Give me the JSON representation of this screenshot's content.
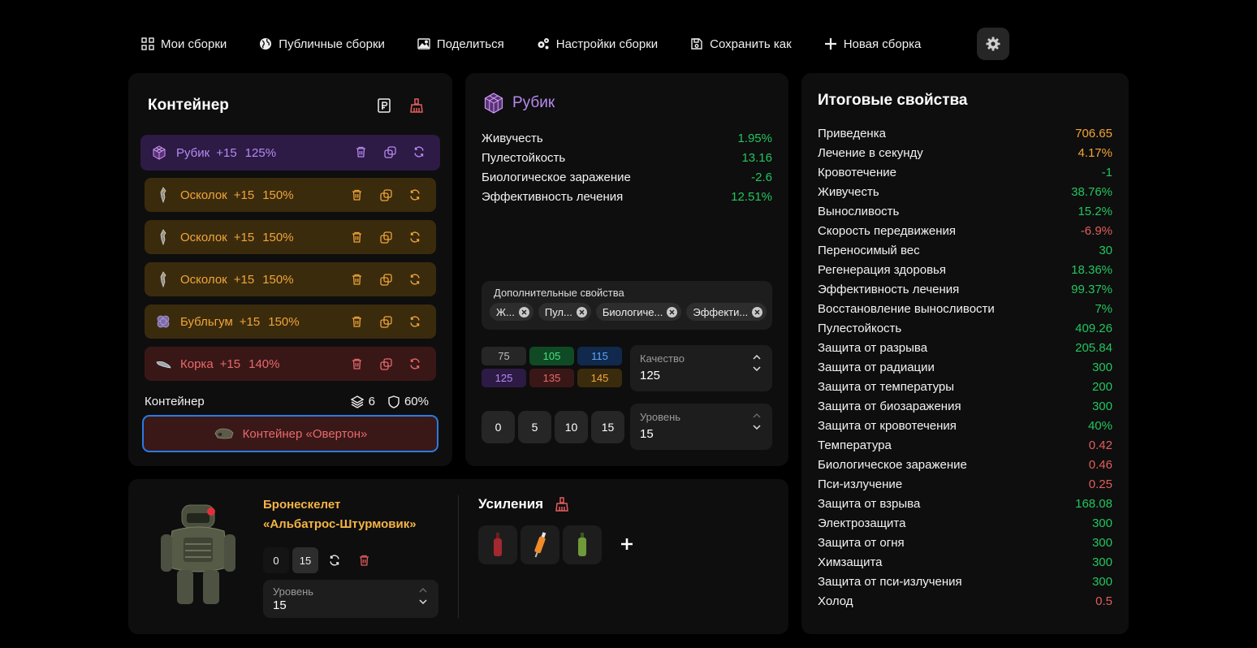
{
  "nav": {
    "items": [
      {
        "label": "Мои сборки",
        "icon": "grid-icon"
      },
      {
        "label": "Публичные сборки",
        "icon": "globe-icon"
      },
      {
        "label": "Поделиться",
        "icon": "image-icon"
      },
      {
        "label": "Настройки сборки",
        "icon": "gears-icon"
      },
      {
        "label": "Сохранить как",
        "icon": "save-icon"
      },
      {
        "label": "Новая сборка",
        "icon": "plus-icon"
      }
    ],
    "settings_icon": "gear-icon"
  },
  "container_panel": {
    "title": "Контейнер",
    "artifacts": [
      {
        "name": "Рубик",
        "plus": "+15",
        "percent": "125%",
        "rarity": "purple"
      },
      {
        "name": "Осколок",
        "plus": "+15",
        "percent": "150%",
        "rarity": "orange"
      },
      {
        "name": "Осколок",
        "plus": "+15",
        "percent": "150%",
        "rarity": "orange"
      },
      {
        "name": "Осколок",
        "plus": "+15",
        "percent": "150%",
        "rarity": "orange"
      },
      {
        "name": "Бубльгум",
        "plus": "+15",
        "percent": "150%",
        "rarity": "orange"
      },
      {
        "name": "Корка",
        "plus": "+15",
        "percent": "140%",
        "rarity": "red"
      }
    ],
    "footer": {
      "label": "Контейнер",
      "slots": "6",
      "protection": "60%"
    },
    "container_button": "Контейнер «Овертон»"
  },
  "artifact_detail": {
    "title": "Рубик",
    "properties": [
      {
        "name": "Живучесть",
        "value": "1.95%",
        "color": "green"
      },
      {
        "name": "Пулестойкость",
        "value": "13.16",
        "color": "green"
      },
      {
        "name": "Биологическое заражение",
        "value": "-2.6",
        "color": "green"
      },
      {
        "name": "Эффективность лечения",
        "value": "12.51%",
        "color": "green"
      }
    ],
    "additional_label": "Дополнительные свойства",
    "chips": [
      "Ж...",
      "Пул...",
      "Биологиче...",
      "Эффекти..."
    ],
    "quality_values": [
      {
        "v": "75",
        "bg": "#262626",
        "fg": "#bdbdbd"
      },
      {
        "v": "105",
        "bg": "#0f4a25",
        "fg": "#4ade80"
      },
      {
        "v": "115",
        "bg": "#10294d",
        "fg": "#60a5fa"
      },
      {
        "v": "125",
        "bg": "#2d1a45",
        "fg": "#b58bf0"
      },
      {
        "v": "135",
        "bg": "#3a1717",
        "fg": "#e8696b"
      },
      {
        "v": "145",
        "bg": "#3b2b0d",
        "fg": "#f0a53a"
      }
    ],
    "quality": {
      "label": "Качество",
      "value": "125"
    },
    "level_buttons": [
      "0",
      "5",
      "10",
      "15"
    ],
    "level": {
      "label": "Уровень",
      "value": "15"
    }
  },
  "armor": {
    "name_line1": "Бронескелет",
    "name_line2": "«Альбатрос-Штурмовик»",
    "levels": [
      "0",
      "15"
    ],
    "level": {
      "label": "Уровень",
      "value": "15"
    },
    "boosts_title": "Усиления"
  },
  "totals": {
    "title": "Итоговые свойства",
    "rows": [
      {
        "name": "Приведенка",
        "value": "706.65",
        "color": "orange"
      },
      {
        "name": "Лечение в секунду",
        "value": "4.17%",
        "color": "orange"
      },
      {
        "name": "Кровотечение",
        "value": "-1",
        "color": "green"
      },
      {
        "name": "Живучесть",
        "value": "38.76%",
        "color": "green"
      },
      {
        "name": "Выносливость",
        "value": "15.2%",
        "color": "green"
      },
      {
        "name": "Скорость передвижения",
        "value": "-6.9%",
        "color": "red"
      },
      {
        "name": "Переносимый вес",
        "value": "30",
        "color": "green"
      },
      {
        "name": "Регенерация здоровья",
        "value": "18.36%",
        "color": "green"
      },
      {
        "name": "Эффективность лечения",
        "value": "99.37%",
        "color": "green"
      },
      {
        "name": "Восстановление выносливости",
        "value": "7%",
        "color": "green"
      },
      {
        "name": "Пулестойкость",
        "value": "409.26",
        "color": "green"
      },
      {
        "name": "Защита от разрыва",
        "value": "205.84",
        "color": "green"
      },
      {
        "name": "Защита от радиации",
        "value": "300",
        "color": "green"
      },
      {
        "name": "Защита от температуры",
        "value": "200",
        "color": "green"
      },
      {
        "name": "Защита от биозаражения",
        "value": "300",
        "color": "green"
      },
      {
        "name": "Защита от кровотечения",
        "value": "40%",
        "color": "green"
      },
      {
        "name": "Температура",
        "value": "0.42",
        "color": "red"
      },
      {
        "name": "Биологическое заражение",
        "value": "0.46",
        "color": "red"
      },
      {
        "name": "Пси-излучение",
        "value": "0.25",
        "color": "red"
      },
      {
        "name": "Защита от взрыва",
        "value": "168.08",
        "color": "green"
      },
      {
        "name": "Электрозащита",
        "value": "300",
        "color": "green"
      },
      {
        "name": "Защита от огня",
        "value": "300",
        "color": "green"
      },
      {
        "name": "Химзащита",
        "value": "300",
        "color": "green"
      },
      {
        "name": "Защита от пси-излучения",
        "value": "300",
        "color": "green"
      },
      {
        "name": "Холод",
        "value": "0.5",
        "color": "red"
      }
    ]
  },
  "colors": {
    "green": "#22c55e",
    "orange": "#f5a436",
    "red": "#e35d5d",
    "purple": "#b58bf0",
    "accent_border": "#2a7be4"
  }
}
